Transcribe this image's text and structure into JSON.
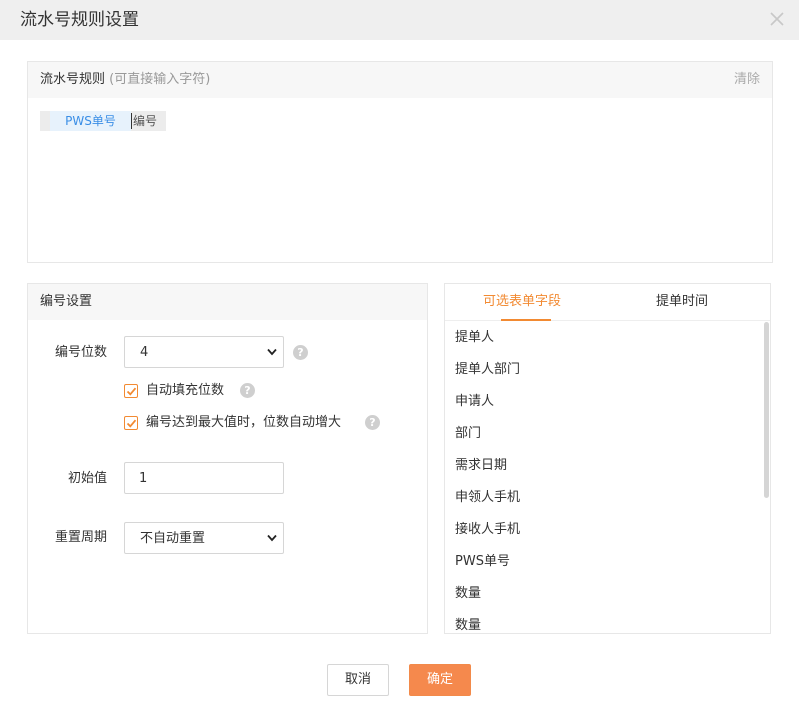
{
  "dialog": {
    "title": "流水号规则设置",
    "close_icon": "close-icon"
  },
  "rule": {
    "title": "流水号规则",
    "hint": "(可直接输入字符)",
    "clear_label": "清除",
    "token_label": "PWS单号",
    "token_text": "编号"
  },
  "numbering": {
    "title": "编号设置",
    "digits_label": "编号位数",
    "digits_value": "4",
    "auto_fill_label": "自动填充位数",
    "auto_fill_checked": true,
    "auto_grow_label": "编号达到最大值时，位数自动增大",
    "auto_grow_checked": true,
    "initial_label": "初始值",
    "initial_value": "1",
    "reset_label": "重置周期",
    "reset_value": "不自动重置",
    "help_glyph": "?"
  },
  "fields": {
    "tabs": [
      {
        "label": "可选表单字段",
        "active": true
      },
      {
        "label": "提单时间",
        "active": false
      }
    ],
    "items": [
      "提单人",
      "提单人部门",
      "申请人",
      "部门",
      "需求日期",
      "申领人手机",
      "接收人手机",
      "PWS单号",
      "数量",
      "数量"
    ]
  },
  "footer": {
    "cancel_label": "取消",
    "ok_label": "确定"
  },
  "colors": {
    "accent": "#f28a32",
    "primary_button": "#f5894d",
    "token_text": "#3a8ee6"
  }
}
